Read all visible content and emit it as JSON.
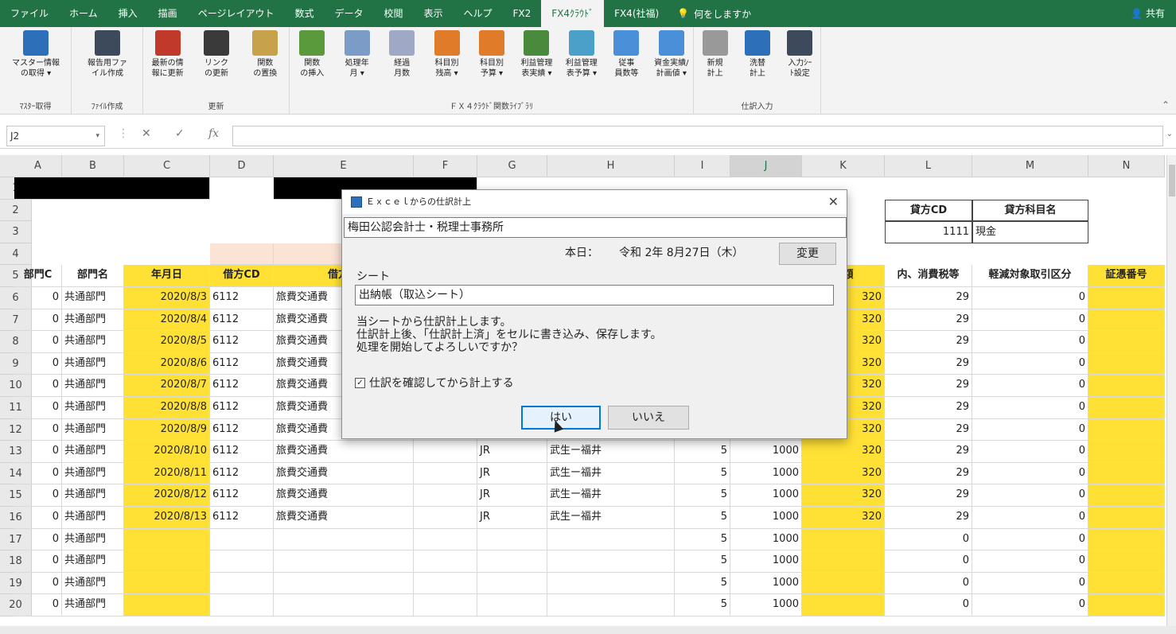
{
  "menubar": {
    "tabs": [
      "ファイル",
      "ホーム",
      "挿入",
      "描画",
      "ページレイアウト",
      "数式",
      "データ",
      "校閲",
      "表示",
      "ヘルプ",
      "FX2",
      "FX4ｸﾗｳﾄﾞ",
      "FX4(社福)"
    ],
    "active_tab": "FX4ｸﾗｳﾄﾞ",
    "search": "何をしますか",
    "share": "共有"
  },
  "ribbon": {
    "groups": [
      {
        "label": "ﾏｽﾀｰ取得",
        "buttons": [
          "マスター情報\nの取得 ▾"
        ]
      },
      {
        "label": "ﾌｧｲﾙ作成",
        "buttons": [
          "報告用ファ\nイル作成"
        ]
      },
      {
        "label": "更新",
        "buttons": [
          "最新の情\n報に更新",
          "リンク\nの更新",
          "関数\nの置換"
        ]
      },
      {
        "label": "ＦＸ４ｸﾗｳﾄﾞ関数ﾗｲﾌﾞﾗﾘ",
        "buttons": [
          "関数\nの挿入",
          "処理年\n月 ▾",
          "経過\n月数",
          "科目別\n残高 ▾",
          "科目別\n予算 ▾",
          "利益管理\n表実績 ▾",
          "利益管理\n表予算 ▾",
          "従事\n員数等",
          "資金実績/\n計画値 ▾"
        ]
      },
      {
        "label": "仕訳入力",
        "buttons": [
          "新規\n計上",
          "洗替\n計上",
          "入力ｼｰ\nﾄ設定"
        ]
      }
    ]
  },
  "formulabar": {
    "namebox": "J2",
    "value": ""
  },
  "grid": {
    "columns": [
      "A",
      "B",
      "C",
      "D",
      "E",
      "F",
      "G",
      "H",
      "I",
      "J",
      "K",
      "L",
      "M",
      "N"
    ],
    "selected_column": "J",
    "rows": [
      "1",
      "2",
      "3",
      "4",
      "5",
      "6",
      "7",
      "8",
      "9",
      "10",
      "11",
      "12",
      "13",
      "14",
      "15",
      "16",
      "17",
      "18",
      "19",
      "20"
    ],
    "header_row": {
      "A": "部門C",
      "B": "部門名",
      "C": "年月日",
      "D": "借方CD",
      "E": "借方科",
      "K": "金額",
      "L": "内、消費税等",
      "M": "軽減対象取引区分",
      "N": "証憑番号"
    },
    "credit_box": {
      "label_cd": "貸方CD",
      "label_name": "貸方科目名",
      "value_cd": "1111",
      "value_name": "現金"
    },
    "data_rows": [
      {
        "a": "0",
        "b": "共通部門",
        "c": "2020/8/3",
        "d": "6112",
        "e": "旅費交通費",
        "g": "",
        "h": "",
        "i": "",
        "j": "",
        "k": "320",
        "l": "29",
        "m": "0"
      },
      {
        "a": "0",
        "b": "共通部門",
        "c": "2020/8/4",
        "d": "6112",
        "e": "旅費交通費",
        "g": "",
        "h": "",
        "i": "",
        "j": "",
        "k": "320",
        "l": "29",
        "m": "0"
      },
      {
        "a": "0",
        "b": "共通部門",
        "c": "2020/8/5",
        "d": "6112",
        "e": "旅費交通費",
        "g": "",
        "h": "",
        "i": "",
        "j": "",
        "k": "320",
        "l": "29",
        "m": "0"
      },
      {
        "a": "0",
        "b": "共通部門",
        "c": "2020/8/6",
        "d": "6112",
        "e": "旅費交通費",
        "g": "",
        "h": "",
        "i": "",
        "j": "",
        "k": "320",
        "l": "29",
        "m": "0"
      },
      {
        "a": "0",
        "b": "共通部門",
        "c": "2020/8/7",
        "d": "6112",
        "e": "旅費交通費",
        "g": "",
        "h": "",
        "i": "",
        "j": "",
        "k": "320",
        "l": "29",
        "m": "0"
      },
      {
        "a": "0",
        "b": "共通部門",
        "c": "2020/8/8",
        "d": "6112",
        "e": "旅費交通費",
        "g": "",
        "h": "",
        "i": "",
        "j": "",
        "k": "320",
        "l": "29",
        "m": "0"
      },
      {
        "a": "0",
        "b": "共通部門",
        "c": "2020/8/9",
        "d": "6112",
        "e": "旅費交通費",
        "g": "",
        "h": "",
        "i": "",
        "j": "",
        "k": "320",
        "l": "29",
        "m": "0"
      },
      {
        "a": "0",
        "b": "共通部門",
        "c": "2020/8/10",
        "d": "6112",
        "e": "旅費交通費",
        "g": "JR",
        "h": "武生ー福井",
        "i": "5",
        "j": "1000",
        "k": "320",
        "l": "29",
        "m": "0"
      },
      {
        "a": "0",
        "b": "共通部門",
        "c": "2020/8/11",
        "d": "6112",
        "e": "旅費交通費",
        "g": "JR",
        "h": "武生ー福井",
        "i": "5",
        "j": "1000",
        "k": "320",
        "l": "29",
        "m": "0"
      },
      {
        "a": "0",
        "b": "共通部門",
        "c": "2020/8/12",
        "d": "6112",
        "e": "旅費交通費",
        "g": "JR",
        "h": "武生ー福井",
        "i": "5",
        "j": "1000",
        "k": "320",
        "l": "29",
        "m": "0"
      },
      {
        "a": "0",
        "b": "共通部門",
        "c": "2020/8/13",
        "d": "6112",
        "e": "旅費交通費",
        "g": "JR",
        "h": "武生ー福井",
        "i": "5",
        "j": "1000",
        "k": "320",
        "l": "29",
        "m": "0"
      },
      {
        "a": "0",
        "b": "共通部門",
        "c": "",
        "d": "",
        "e": "",
        "g": "",
        "h": "",
        "i": "5",
        "j": "1000",
        "k": "",
        "l": "0",
        "m": "0"
      },
      {
        "a": "0",
        "b": "共通部門",
        "c": "",
        "d": "",
        "e": "",
        "g": "",
        "h": "",
        "i": "5",
        "j": "1000",
        "k": "",
        "l": "0",
        "m": "0"
      },
      {
        "a": "0",
        "b": "共通部門",
        "c": "",
        "d": "",
        "e": "",
        "g": "",
        "h": "",
        "i": "5",
        "j": "1000",
        "k": "",
        "l": "0",
        "m": "0"
      },
      {
        "a": "0",
        "b": "共通部門",
        "c": "",
        "d": "",
        "e": "",
        "g": "",
        "h": "",
        "i": "5",
        "j": "1000",
        "k": "",
        "l": "0",
        "m": "0"
      }
    ]
  },
  "dialog": {
    "title": "Ｅｘｃｅｌからの仕訳計上",
    "office": "梅田公認会計士・税理士事務所",
    "date_label": "本日：",
    "date_value": "令和 2年 8月27日（木）",
    "change_button": "変更",
    "sheet_label": "シート",
    "sheet_value": "出納帳（取込シート）",
    "message": [
      "当シートから仕訳計上します。",
      "仕訳計上後、「仕訳計上済」をセルに書き込み、保存します。",
      "処理を開始してよろしいですか？"
    ],
    "checkbox_label": "仕訳を確認してから計上する",
    "checkbox_checked": true,
    "yes_button": "はい",
    "no_button": "いいえ"
  },
  "colors": {
    "excel_green": "#217346",
    "yellow": "#ffe135",
    "peach": "#fbe4d5",
    "focus_blue": "#0078d7"
  }
}
